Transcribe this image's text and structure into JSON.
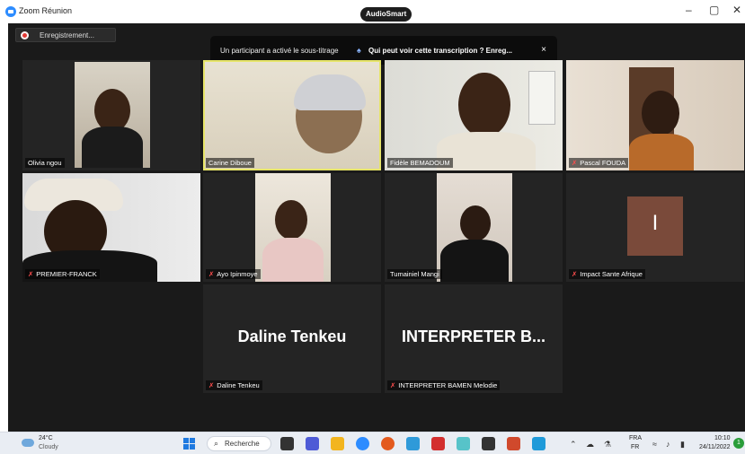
{
  "window": {
    "title": "Zoom Réunion",
    "center_badge": "AudioSmart",
    "minimize": "–",
    "maximize": "▢",
    "close": "✕"
  },
  "recording": {
    "label": "Enregistrement..."
  },
  "banner": {
    "message": "Un participant a activé le sous-titrage",
    "link": "Qui peut voir cette transcription ? Enreg...",
    "close": "×"
  },
  "participants": [
    {
      "name": "Olivia ngou",
      "muted": false
    },
    {
      "name": "Carine Diboue",
      "muted": false,
      "active_speaker": true
    },
    {
      "name": "Fidèle BEMADOUM",
      "muted": false
    },
    {
      "name": "Pascal FOUDA",
      "muted": true
    },
    {
      "name": "PREMIER-FRANCK",
      "muted": true
    },
    {
      "name": "Ayo Ipinmoye",
      "muted": true
    },
    {
      "name": "Tumainiel Mangi",
      "muted": false
    },
    {
      "name": "Impact Sante Afrique",
      "muted": true,
      "avatar_letter": "I"
    },
    {
      "name": "Daline Tenkeu",
      "display": "Daline Tenkeu",
      "muted": true
    },
    {
      "name": "INTERPRETER BAMEN Melodie",
      "display": "INTERPRETER B...",
      "muted": true
    }
  ],
  "taskbar": {
    "temperature": "24°C",
    "condition": "Cloudy",
    "search_label": "Recherche",
    "language_line1": "FRA",
    "language_line2": "FR",
    "time": "10:10",
    "date": "24/11/2022",
    "notifications": "1"
  },
  "colors": {
    "stage_bg": "#1a1a1a",
    "tile_bg": "#242424",
    "active_speaker_border": "#e7e56a",
    "muted_mic": "#ff4d4d",
    "avatar_bg": "#7a4a3a"
  }
}
